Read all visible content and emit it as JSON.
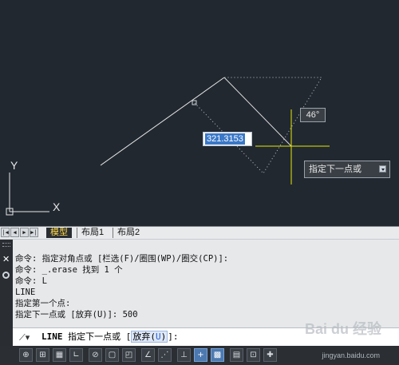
{
  "viewport": {
    "dimension_value": "321.3153",
    "angle_tooltip": "46°",
    "prompt_tooltip": "指定下一点或",
    "ucs": {
      "y_label": "Y",
      "x_label": "X"
    }
  },
  "layout_tabs": {
    "nav": [
      "|◀",
      "◀",
      "▶",
      "▶|"
    ],
    "tabs": [
      "模型",
      "布局1",
      "布局2"
    ],
    "active": "模型"
  },
  "command_history": [
    "命令: 指定对角点或 [栏选(F)/圈围(WP)/圈交(CP)]:",
    "命令: _.erase 找到 1 个",
    "命令: L",
    "LINE",
    "指定第一个点:",
    "指定下一点或 [放弃(U)]: 500"
  ],
  "command_line": {
    "icon": "⟋▾",
    "command": "LINE",
    "prompt": "指定下一点或",
    "option_bracket_open": "[",
    "option_label": "放弃(",
    "option_key": "U",
    "option_close": ")",
    "bracket_close": "]:"
  },
  "status_bar": {
    "buttons": [
      "⊕",
      "⊞",
      "▦",
      "∟",
      "⊘",
      "▢",
      "◰",
      "∠",
      "⋰",
      "⊥",
      "+",
      "▩",
      "▤",
      "⊡",
      "✚"
    ],
    "on": [
      10,
      11
    ],
    "watermark": "jingyan.baidu.com"
  },
  "brand_watermark": "Bai du 经验",
  "colors": {
    "canvas_bg": "#212830",
    "crosshair": "#e6e600",
    "active_tab_text": "#ffd84a",
    "selection_blue": "#3a78c8"
  }
}
